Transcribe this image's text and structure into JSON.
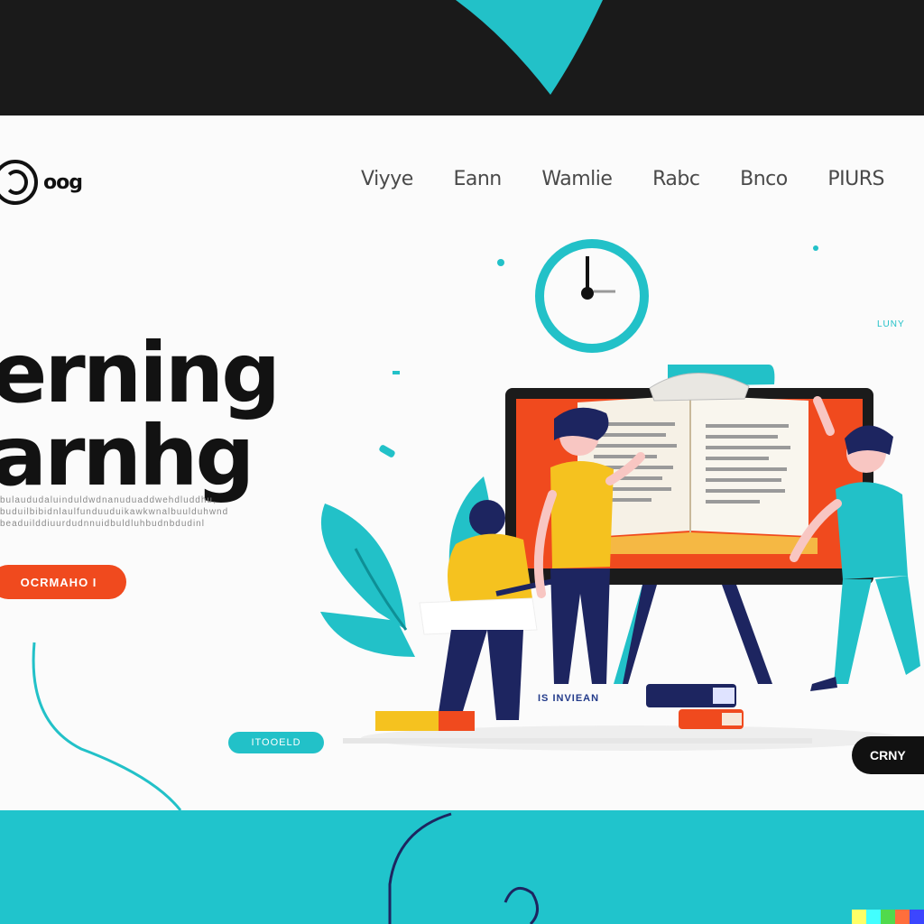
{
  "colors": {
    "accent_teal": "#22c1c8",
    "accent_orange": "#f04a1e",
    "dark": "#111111",
    "yellow": "#f5c21f",
    "navy": "#1d2560"
  },
  "header": {
    "logo_text": "oog",
    "nav": [
      "Viyye",
      "Eann",
      "Wamlie",
      "Rabc",
      "Bnco",
      "PIURS"
    ]
  },
  "hero": {
    "title_lines": [
      "erning",
      "arnhg"
    ],
    "desc_lines": [
      "bulaududaluinduldwdnanuduaddwehdluddhu,",
      "buduilbibidnlaulfunduuduikawkwnalbuulduhwnd",
      "beaduilddiuurdudnnuidbuldluhbudnbdudinl"
    ],
    "cta_label": "OCRMAHO I"
  },
  "labels": {
    "pill_badge": "ITOOELD",
    "dark_button": "CRNY",
    "side_label": "LUNY",
    "books_label": "IS INVIEAN"
  },
  "icons": [
    "clock-icon",
    "logo-icon",
    "book-icon",
    "leaf-icon"
  ],
  "attribution_colors": [
    "#ffff66",
    "#42ffff",
    "#51da4c",
    "#ff6e3c",
    "#3c46ff"
  ]
}
